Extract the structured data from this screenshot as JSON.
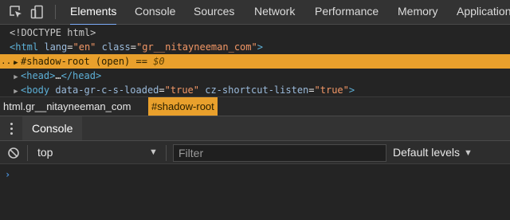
{
  "tabs": [
    {
      "label": "Elements",
      "active": true
    },
    {
      "label": "Console",
      "active": false
    },
    {
      "label": "Sources",
      "active": false
    },
    {
      "label": "Network",
      "active": false
    },
    {
      "label": "Performance",
      "active": false
    },
    {
      "label": "Memory",
      "active": false
    },
    {
      "label": "Application",
      "active": false
    }
  ],
  "toolbar_icons": [
    "inspect-element-icon",
    "device-toggle-icon"
  ],
  "tree": {
    "doctype": "<!DOCTYPE html>",
    "html_line": {
      "open": "<html",
      "attr1": "lang",
      "val1": "\"en\"",
      "attr2": "class",
      "val2": "\"gr__nitayneeman_com\"",
      "close": ">"
    },
    "shadow_line": {
      "dots": "...",
      "text": "#shadow-root (open)",
      "eq": "==",
      "dollar": "$0",
      "selected": true
    },
    "head_line": {
      "open": "<head>",
      "ellipsis": "…",
      "close": "</head>"
    },
    "body_line": {
      "open": "<body",
      "attr1": "data-gr-c-s-loaded",
      "val1": "\"true\"",
      "attr2": "cz-shortcut-listen",
      "val2": "\"true\"",
      "close": ">"
    }
  },
  "breadcrumb": [
    {
      "label": "html.gr__nitayneeman_com",
      "active": false
    },
    {
      "label": "#shadow-root",
      "active": true
    }
  ],
  "drawer": {
    "tab_label": "Console"
  },
  "console_toolbar": {
    "context": "top",
    "filter_placeholder": "Filter",
    "levels": "Default levels"
  },
  "console_prompt": "›",
  "colors": {
    "selection": "#e9a02c",
    "tag": "#5db0d7",
    "attribute": "#9bbbdc",
    "value": "#f29766",
    "active_tab_underline": "#7cacf8"
  }
}
